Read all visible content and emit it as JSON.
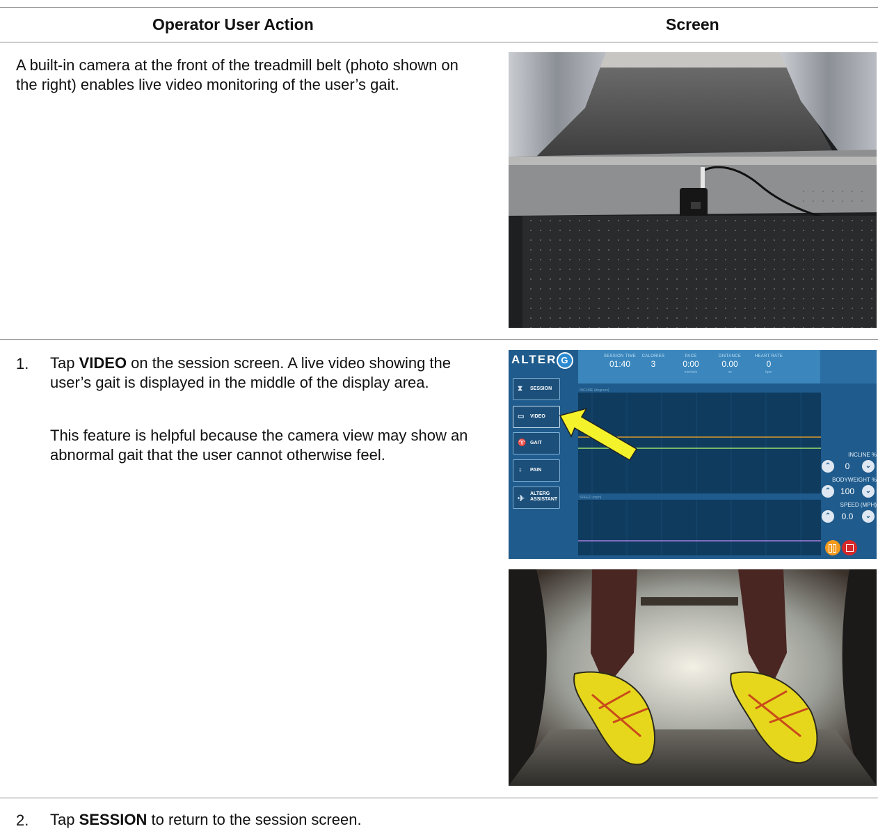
{
  "table": {
    "header_left": "Operator User Action",
    "header_right": "Screen"
  },
  "row1": {
    "text": "A built-in camera at the front of the treadmill belt (photo shown on the right) enables live video monitoring of the user’s gait."
  },
  "step1": {
    "number": "1.",
    "text_before": "Tap ",
    "keyword": "VIDEO",
    "text_after": " on the session screen. A live video showing the user’s gait is displayed in the middle of the display area.",
    "note": "This feature is helpful because the camera view may show an abnormal gait that the user cannot otherwise feel."
  },
  "step2": {
    "number": "2.",
    "text_before": "Tap ",
    "keyword": "SESSION",
    "text_after": " to return to the session screen."
  },
  "ui": {
    "logo": "ALTER",
    "logo_g": "G",
    "stats": [
      {
        "label": "SESSION TIME",
        "value": "01:40",
        "unit": ""
      },
      {
        "label": "CALORIES",
        "value": "3",
        "unit": ""
      },
      {
        "label": "PACE",
        "value": "0:00",
        "unit": "min/mile"
      },
      {
        "label": "DISTANCE",
        "value": "0.00",
        "unit": "mi"
      },
      {
        "label": "HEART RATE",
        "value": "0",
        "unit": "bpm"
      }
    ],
    "nav": [
      {
        "label": "SESSION",
        "icon": "hourglass-icon"
      },
      {
        "label": "VIDEO",
        "icon": "video-icon"
      },
      {
        "label": "GAIT",
        "icon": "footprints-icon"
      },
      {
        "label": "PAIN",
        "icon": "body-icon"
      },
      {
        "label_line1": "ALTERG",
        "label_line2": "ASSISTANT",
        "icon": "runner-icon"
      }
    ],
    "panel1_caption": "INCLINE (degrees)",
    "panel2_caption": "SPEED (mph)",
    "incline_label": "INCLINE %",
    "incline_value": "0",
    "bodyweight_label": "BODYWEIGHT %",
    "bodyweight_value": "100",
    "speed_label": "SPEED (MPH)",
    "speed_value": "0.0",
    "colors": {
      "background": "#1f5b8c",
      "stat_bar": "#3a86bd",
      "pause": "#f39a1d",
      "stop": "#d6292b",
      "arrow": "#f4f22a"
    }
  }
}
